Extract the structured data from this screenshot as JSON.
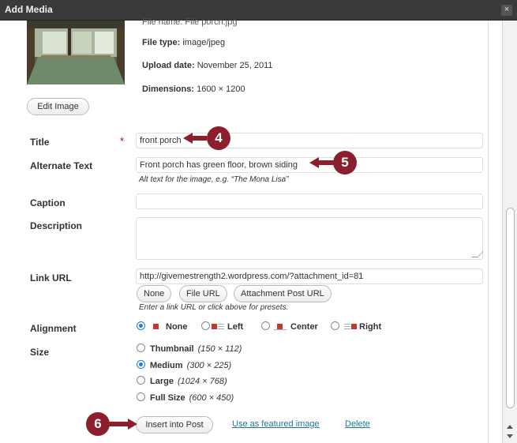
{
  "window": {
    "title": "Add Media",
    "close_glyph": "×"
  },
  "meta": {
    "file_name_cut": "File name: File porch.jpg",
    "file_type_label": "File type:",
    "file_type_value": "image/jpeg",
    "upload_date_label": "Upload date:",
    "upload_date_value": "November 25, 2011",
    "dimensions_label": "Dimensions:",
    "dimensions_value": "1600 × 1200"
  },
  "edit_image_label": "Edit Image",
  "fields": {
    "title": {
      "label": "Title",
      "required": "*",
      "value": "front porch"
    },
    "alt": {
      "label": "Alternate Text",
      "value": "Front porch has green floor, brown siding",
      "help": "Alt text for the image, e.g. “The Mona Lisa”"
    },
    "caption": {
      "label": "Caption",
      "value": ""
    },
    "description": {
      "label": "Description",
      "value": ""
    },
    "link": {
      "label": "Link URL",
      "value": "http://givemestrength2.wordpress.com/?attachment_id=81",
      "buttons": [
        "None",
        "File URL",
        "Attachment Post URL"
      ],
      "help": "Enter a link URL or click above for presets."
    },
    "alignment": {
      "label": "Alignment",
      "options": [
        "None",
        "Left",
        "Center",
        "Right"
      ],
      "selected": "None"
    },
    "size": {
      "label": "Size",
      "options": [
        {
          "name": "Thumbnail",
          "dims": "(150 × 112)"
        },
        {
          "name": "Medium",
          "dims": "(300 × 225)"
        },
        {
          "name": "Large",
          "dims": "(1024 × 768)"
        },
        {
          "name": "Full Size",
          "dims": "(600 × 450)"
        }
      ],
      "selected": "Medium"
    }
  },
  "actions": {
    "insert": "Insert into Post",
    "featured": "Use as featured image",
    "delete": "Delete"
  },
  "callouts": [
    "4",
    "5",
    "6"
  ],
  "colors": {
    "callout": "#8c1e2e",
    "link": "#21759b",
    "radio_selected": "#2a7ad8"
  }
}
